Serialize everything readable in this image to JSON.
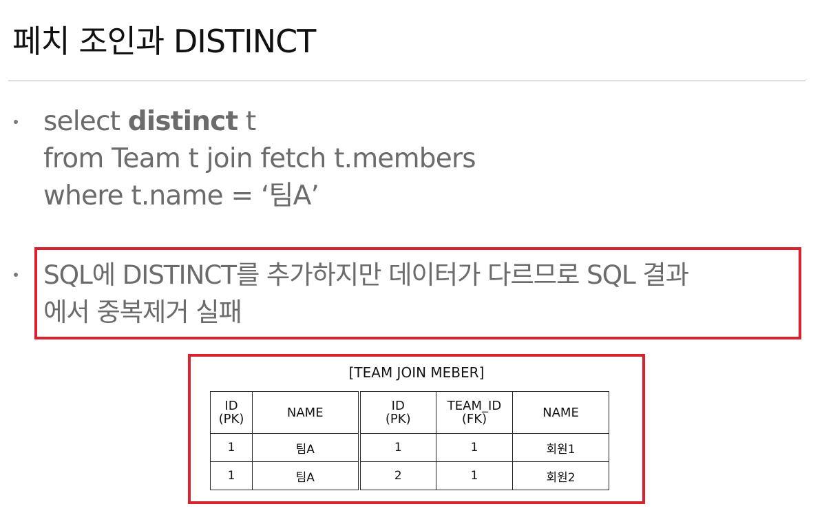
{
  "title": "페치 조인과 DISTINCT",
  "bullet1": {
    "line1_prefix": "select ",
    "line1_bold": "distinct",
    "line1_suffix": " t",
    "line2": "from Team t join fetch t.members",
    "line3": "where t.name = ‘팀A’"
  },
  "bullet2": {
    "line1": "SQL에 DISTINCT를 추가하지만 데이터가 다르므로 SQL 결과",
    "line2": "에서 중복제거 실패"
  },
  "table": {
    "caption": "[TEAM JOIN MEBER]",
    "headers": [
      {
        "line1": "ID",
        "line2": "(PK)"
      },
      {
        "line1": "NAME",
        "line2": ""
      },
      {
        "line1": "ID",
        "line2": "(PK)"
      },
      {
        "line1": "TEAM_ID",
        "line2": "(FK)"
      },
      {
        "line1": "NAME",
        "line2": ""
      }
    ],
    "rows": [
      [
        "1",
        "팀A",
        "1",
        "1",
        "회원1"
      ],
      [
        "1",
        "팀A",
        "2",
        "1",
        "회원2"
      ]
    ]
  },
  "colors": {
    "highlight_border": "#d8232e",
    "body_text": "#6b6b6b",
    "title_text": "#111111"
  }
}
